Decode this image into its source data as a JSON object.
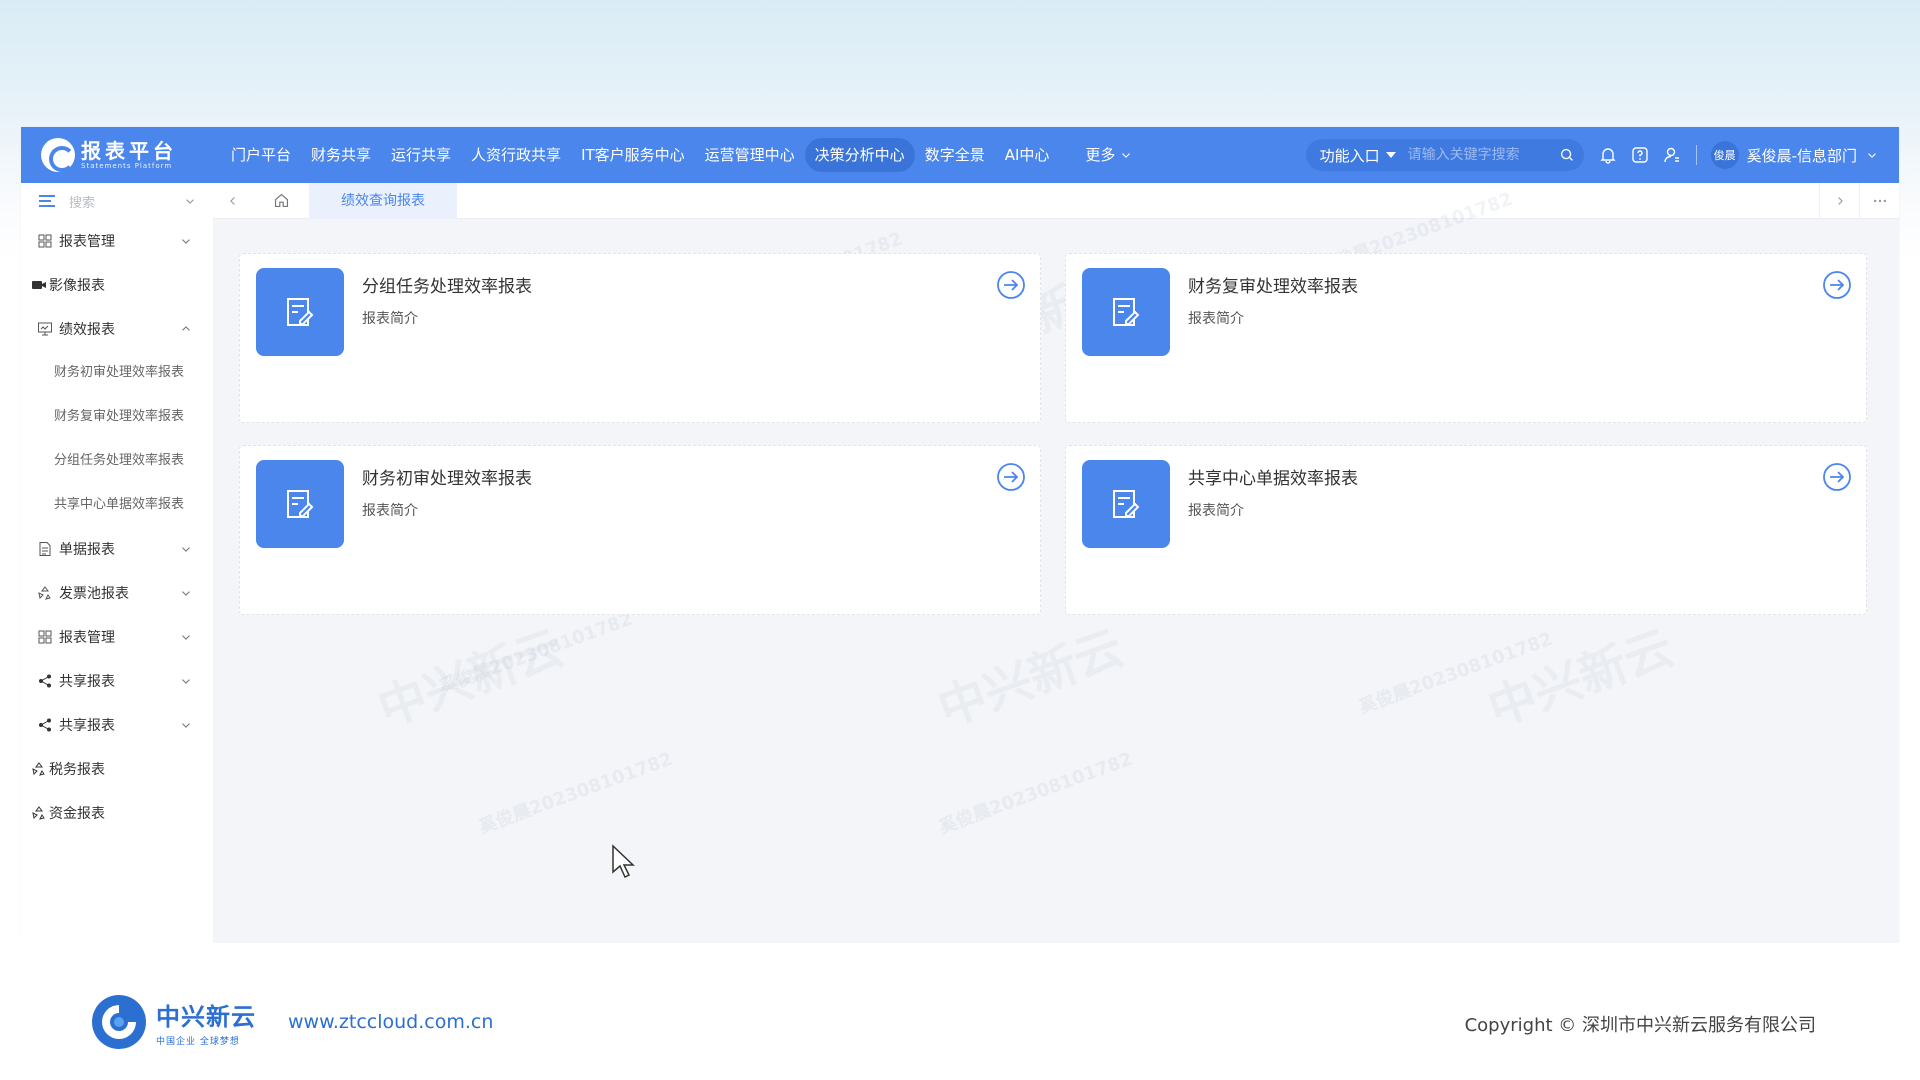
{
  "brand": {
    "title": "报表平台",
    "subtitle": "Statements Platform"
  },
  "nav": {
    "items": [
      "门户平台",
      "财务共享",
      "运行共享",
      "人资行政共享",
      "IT客户服务中心",
      "运营管理中心",
      "决策分析中心",
      "数字全景",
      "AI中心"
    ],
    "active_index": 6,
    "more_label": "更多"
  },
  "toolbar": {
    "func_entry_label": "功能入口",
    "search_placeholder": "请输入关键字搜索",
    "user_avatar_text": "俊晨",
    "user_label": "奚俊晨-信息部门"
  },
  "sidebar": {
    "search_label": "搜索",
    "items": [
      {
        "label": "报表管理",
        "icon": "grid-icon",
        "expanded": false
      },
      {
        "label": "影像报表",
        "icon": "video-icon"
      },
      {
        "label": "绩效报表",
        "icon": "monitor-icon",
        "expanded": true,
        "children": [
          "财务初审处理效率报表",
          "财务复审处理效率报表",
          "分组任务处理效率报表",
          "共享中心单据效率报表"
        ]
      },
      {
        "label": "单据报表",
        "icon": "document-icon",
        "expanded": false
      },
      {
        "label": "发票池报表",
        "icon": "recycle-icon",
        "expanded": false
      },
      {
        "label": "报表管理",
        "icon": "grid-icon",
        "expanded": false
      },
      {
        "label": "共享报表",
        "icon": "share-icon",
        "expanded": false
      },
      {
        "label": "共享报表",
        "icon": "share-icon",
        "expanded": false
      },
      {
        "label": "税务报表",
        "icon": "recycle-icon"
      },
      {
        "label": "资金报表",
        "icon": "recycle-icon"
      }
    ]
  },
  "tabs": {
    "active_label": "绩效查询报表"
  },
  "cards": [
    {
      "title": "分组任务处理效率报表",
      "desc": "报表简介"
    },
    {
      "title": "财务复审处理效率报表",
      "desc": "报表简介"
    },
    {
      "title": "财务初审处理效率报表",
      "desc": "报表简介"
    },
    {
      "title": "共享中心单据效率报表",
      "desc": "报表简介"
    }
  ],
  "watermark": {
    "company": "中兴新云",
    "id_text": "奚俊晨202308101782"
  },
  "footer": {
    "logo_name": "中兴新云",
    "logo_slogan": "中国企业 全球梦想",
    "url": "www.ztccloud.com.cn",
    "copyright": "Copyright © 深圳市中兴新云服务有限公司"
  },
  "colors": {
    "primary": "#4a86ec",
    "active_nav": "#3b74d8",
    "footer_text": "#2b6fd0"
  }
}
